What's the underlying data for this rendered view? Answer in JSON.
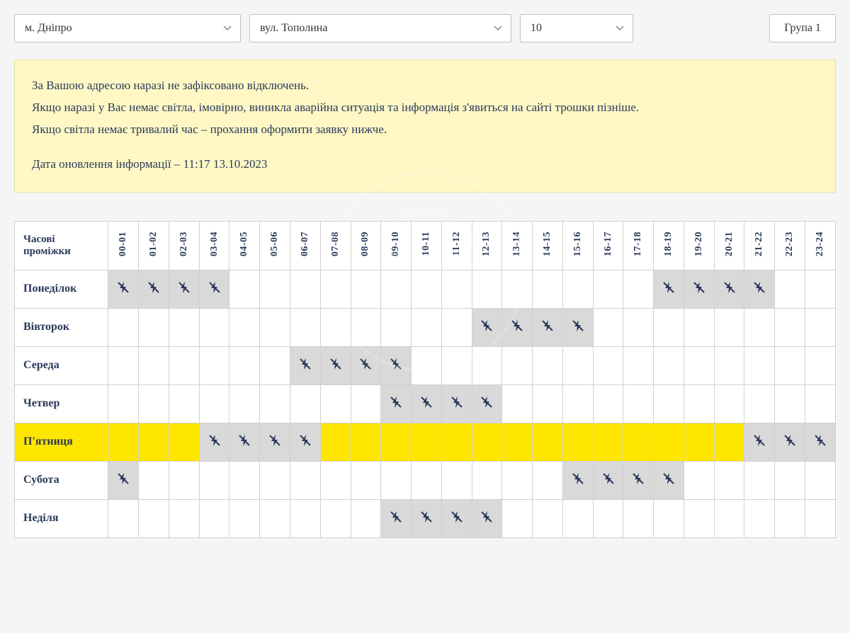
{
  "filters": {
    "city": "м. Дніпро",
    "street": "вул. Тополина",
    "house": "10",
    "group": "Група 1"
  },
  "notice": {
    "line1": "За Вашою адресою наразі не зафіксовано відключень.",
    "line2": "Якщо наразі у Вас немає світла, імовірно, виникла аварійна ситуація та інформація з'явиться на сайті трошки пізніше.",
    "line3": "Якщо світла немає тривалий час – прохання оформити заявку нижче.",
    "line4": "Дата оновлення інформації – 11:17 13.10.2023"
  },
  "schedule": {
    "header_label": "Часові проміжки",
    "time_slots": [
      "00-01",
      "01-02",
      "02-03",
      "03-04",
      "04-05",
      "05-06",
      "06-07",
      "07-08",
      "08-09",
      "09-10",
      "10-11",
      "11-12",
      "12-13",
      "13-14",
      "14-15",
      "15-16",
      "16-17",
      "17-18",
      "18-19",
      "19-20",
      "20-21",
      "21-22",
      "22-23",
      "23-24"
    ],
    "days": [
      {
        "name": "Понеділок",
        "highlight": false,
        "off": [
          0,
          1,
          2,
          3,
          18,
          19,
          20,
          21
        ]
      },
      {
        "name": "Вівторок",
        "highlight": false,
        "off": [
          12,
          13,
          14,
          15
        ]
      },
      {
        "name": "Середа",
        "highlight": false,
        "off": [
          6,
          7,
          8,
          9
        ]
      },
      {
        "name": "Четвер",
        "highlight": false,
        "off": [
          9,
          10,
          11,
          12
        ]
      },
      {
        "name": "П'ятниця",
        "highlight": true,
        "off": [
          3,
          4,
          5,
          6,
          21,
          22,
          23
        ]
      },
      {
        "name": "Субота",
        "highlight": false,
        "off": [
          0,
          15,
          16,
          17,
          18
        ]
      },
      {
        "name": "Неділя",
        "highlight": false,
        "off": [
          9,
          10,
          11,
          12
        ]
      }
    ]
  }
}
